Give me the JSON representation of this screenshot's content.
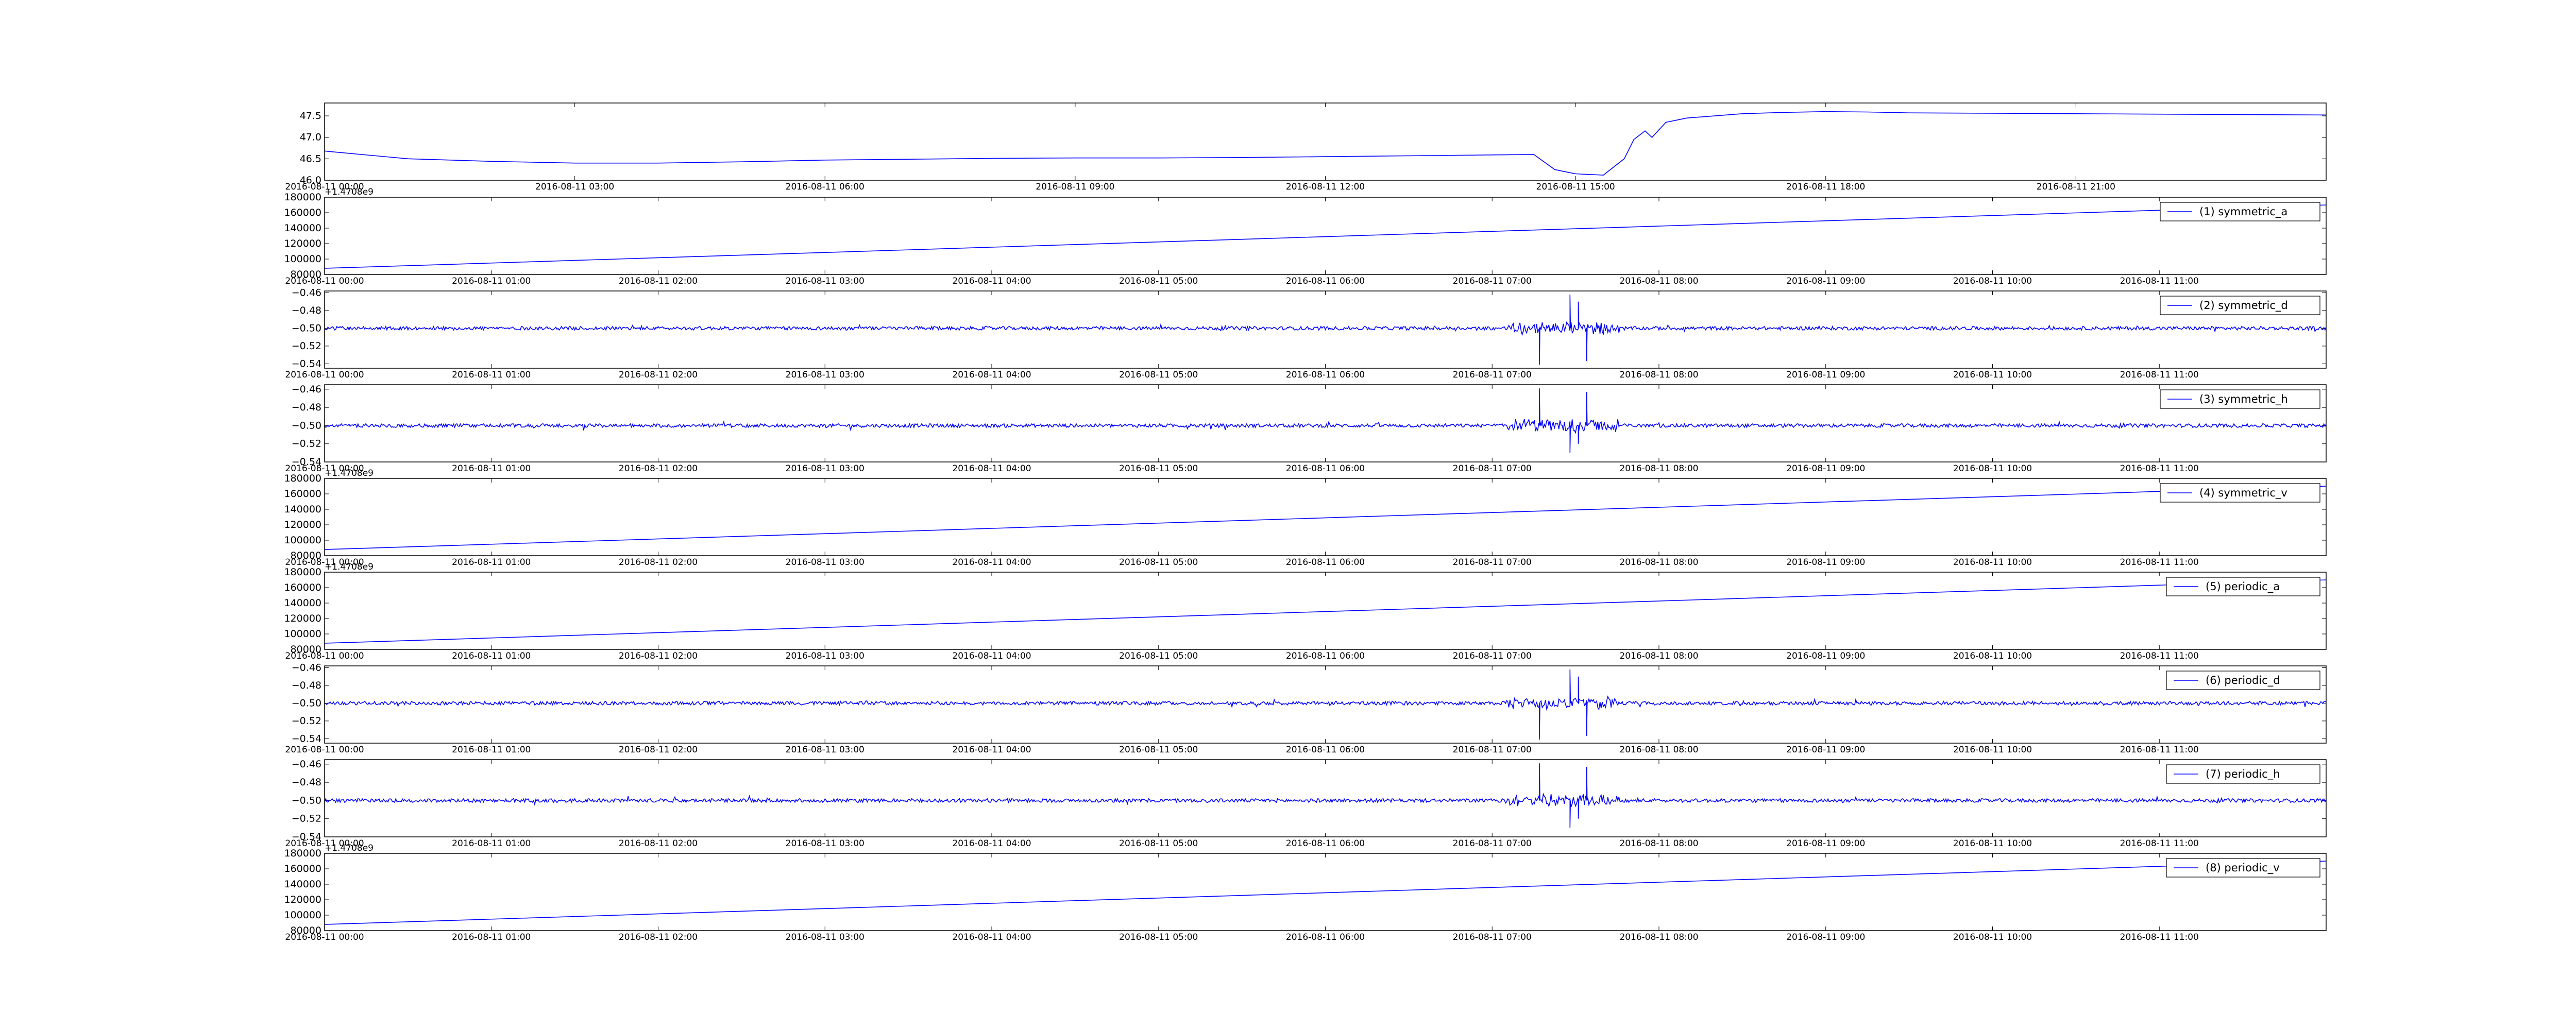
{
  "chart_data": [
    {
      "type": "line",
      "title": "",
      "xlabel": "",
      "ylabel": "",
      "legend": null,
      "grid": false,
      "x_tick_labels": [
        "2016-08-11 00:00",
        "2016-08-11 03:00",
        "2016-08-11 06:00",
        "2016-08-11 09:00",
        "2016-08-11 12:00",
        "2016-08-11 15:00",
        "2016-08-11 18:00",
        "2016-08-11 21:00"
      ],
      "y_tick_labels": [
        "46.0",
        "46.5",
        "47.0",
        "47.5"
      ],
      "xlim": [
        "2016-08-11 00:00",
        "2016-08-11 24:00"
      ],
      "ylim": [
        46.0,
        47.8
      ],
      "color": "#0000ff",
      "series": [
        {
          "x": [
            "00:00",
            "01:00",
            "02:00",
            "03:00",
            "04:00",
            "05:00",
            "06:00",
            "07:00",
            "08:00",
            "09:00",
            "10:00",
            "11:00",
            "12:00",
            "13:00",
            "14:00",
            "14:30",
            "14:45",
            "15:00",
            "15:20",
            "15:35",
            "15:42",
            "15:50",
            "15:55",
            "16:05",
            "16:20",
            "17:00",
            "17:30",
            "18:00",
            "18:30",
            "19:00",
            "20:00",
            "21:00",
            "22:00",
            "23:00",
            "24:00"
          ],
          "values": [
            46.68,
            46.5,
            46.44,
            46.4,
            46.4,
            46.43,
            46.47,
            46.49,
            46.51,
            46.52,
            46.52,
            46.53,
            46.55,
            46.57,
            46.59,
            46.6,
            46.25,
            46.15,
            46.12,
            46.5,
            46.95,
            47.15,
            47.0,
            47.35,
            47.45,
            47.55,
            47.58,
            47.6,
            47.59,
            47.57,
            47.56,
            47.55,
            47.54,
            47.53,
            47.52
          ]
        }
      ]
    },
    {
      "type": "line",
      "legend": "(1) symmetric_a",
      "legend_placement": "top-right",
      "offset_text": "+1.4708e9",
      "x_tick_labels": [
        "2016-08-11 00:00",
        "2016-08-11 01:00",
        "2016-08-11 02:00",
        "2016-08-11 03:00",
        "2016-08-11 04:00",
        "2016-08-11 05:00",
        "2016-08-11 06:00",
        "2016-08-11 07:00",
        "2016-08-11 08:00",
        "2016-08-11 09:00",
        "2016-08-11 10:00",
        "2016-08-11 11:00"
      ],
      "y_tick_labels": [
        "80000",
        "100000",
        "120000",
        "140000",
        "160000",
        "180000"
      ],
      "xlim": [
        "2016-08-11 00:00",
        "2016-08-11 12:00"
      ],
      "ylim": [
        80000,
        180000
      ],
      "color": "#0000ff",
      "series": [
        {
          "name": "(1) symmetric_a",
          "x": [
            "00:00",
            "12:00"
          ],
          "values": [
            88000,
            170000
          ]
        }
      ]
    },
    {
      "type": "line",
      "legend": "(2) symmetric_d",
      "legend_placement": "top-right",
      "pattern": "burst_up",
      "x_tick_labels": [
        "2016-08-11 00:00",
        "2016-08-11 01:00",
        "2016-08-11 02:00",
        "2016-08-11 03:00",
        "2016-08-11 04:00",
        "2016-08-11 05:00",
        "2016-08-11 06:00",
        "2016-08-11 07:00",
        "2016-08-11 08:00",
        "2016-08-11 09:00",
        "2016-08-11 10:00",
        "2016-08-11 11:00"
      ],
      "y_tick_labels": [
        "−0.54",
        "−0.52",
        "−0.50",
        "−0.48",
        "−0.46"
      ],
      "xlim": [
        "2016-08-11 00:00",
        "2016-08-11 12:00"
      ],
      "ylim": [
        -0.545,
        -0.458
      ],
      "baseline": -0.5,
      "color": "#0000ff",
      "series": [
        {
          "name": "(2) symmetric_d",
          "baseline": -0.5,
          "noise_amplitude": 0.002,
          "spikes": [
            {
              "x": "07:17",
              "value": -0.541
            },
            {
              "x": "07:28",
              "value": -0.462
            },
            {
              "x": "07:31",
              "value": -0.47
            },
            {
              "x": "07:34",
              "value": -0.537
            }
          ]
        }
      ]
    },
    {
      "type": "line",
      "legend": "(3) symmetric_h",
      "legend_placement": "top-right",
      "pattern": "burst_down",
      "x_tick_labels": [
        "2016-08-11 00:00",
        "2016-08-11 01:00",
        "2016-08-11 02:00",
        "2016-08-11 03:00",
        "2016-08-11 04:00",
        "2016-08-11 05:00",
        "2016-08-11 06:00",
        "2016-08-11 07:00",
        "2016-08-11 08:00",
        "2016-08-11 09:00",
        "2016-08-11 10:00",
        "2016-08-11 11:00"
      ],
      "y_tick_labels": [
        "−0.54",
        "−0.52",
        "−0.50",
        "−0.48",
        "−0.46"
      ],
      "xlim": [
        "2016-08-11 00:00",
        "2016-08-11 12:00"
      ],
      "ylim": [
        -0.54,
        -0.455
      ],
      "baseline": -0.5,
      "color": "#0000ff",
      "series": [
        {
          "name": "(3) symmetric_h",
          "baseline": -0.5,
          "noise_amplitude": 0.002,
          "spikes": [
            {
              "x": "07:17",
              "value": -0.459
            },
            {
              "x": "07:28",
              "value": -0.53
            },
            {
              "x": "07:31",
              "value": -0.52
            },
            {
              "x": "07:34",
              "value": -0.463
            }
          ]
        }
      ]
    },
    {
      "type": "line",
      "legend": "(4) symmetric_v",
      "legend_placement": "top-right",
      "offset_text": "+1.4708e9",
      "x_tick_labels": [
        "2016-08-11 00:00",
        "2016-08-11 01:00",
        "2016-08-11 02:00",
        "2016-08-11 03:00",
        "2016-08-11 04:00",
        "2016-08-11 05:00",
        "2016-08-11 06:00",
        "2016-08-11 07:00",
        "2016-08-11 08:00",
        "2016-08-11 09:00",
        "2016-08-11 10:00",
        "2016-08-11 11:00"
      ],
      "y_tick_labels": [
        "80000",
        "100000",
        "120000",
        "140000",
        "160000",
        "180000"
      ],
      "xlim": [
        "2016-08-11 00:00",
        "2016-08-11 12:00"
      ],
      "ylim": [
        80000,
        180000
      ],
      "color": "#0000ff",
      "series": [
        {
          "name": "(4) symmetric_v",
          "x": [
            "00:00",
            "12:00"
          ],
          "values": [
            88000,
            170000
          ]
        }
      ]
    },
    {
      "type": "line",
      "legend": "(5) periodic_a",
      "legend_placement": "top-right",
      "offset_text": "+1.4708e9",
      "x_tick_labels": [
        "2016-08-11 00:00",
        "2016-08-11 01:00",
        "2016-08-11 02:00",
        "2016-08-11 03:00",
        "2016-08-11 04:00",
        "2016-08-11 05:00",
        "2016-08-11 06:00",
        "2016-08-11 07:00",
        "2016-08-11 08:00",
        "2016-08-11 09:00",
        "2016-08-11 10:00",
        "2016-08-11 11:00"
      ],
      "y_tick_labels": [
        "80000",
        "100000",
        "120000",
        "140000",
        "160000",
        "180000"
      ],
      "xlim": [
        "2016-08-11 00:00",
        "2016-08-11 12:00"
      ],
      "ylim": [
        80000,
        180000
      ],
      "color": "#0000ff",
      "series": [
        {
          "name": "(5) periodic_a",
          "x": [
            "00:00",
            "12:00"
          ],
          "values": [
            88000,
            170000
          ]
        }
      ]
    },
    {
      "type": "line",
      "legend": "(6) periodic_d",
      "legend_placement": "top-right",
      "pattern": "burst_up",
      "x_tick_labels": [
        "2016-08-11 00:00",
        "2016-08-11 01:00",
        "2016-08-11 02:00",
        "2016-08-11 03:00",
        "2016-08-11 04:00",
        "2016-08-11 05:00",
        "2016-08-11 06:00",
        "2016-08-11 07:00",
        "2016-08-11 08:00",
        "2016-08-11 09:00",
        "2016-08-11 10:00",
        "2016-08-11 11:00"
      ],
      "y_tick_labels": [
        "−0.54",
        "−0.52",
        "−0.50",
        "−0.48",
        "−0.46"
      ],
      "xlim": [
        "2016-08-11 00:00",
        "2016-08-11 12:00"
      ],
      "ylim": [
        -0.545,
        -0.458
      ],
      "baseline": -0.5,
      "color": "#0000ff",
      "series": [
        {
          "name": "(6) periodic_d",
          "baseline": -0.5,
          "noise_amplitude": 0.002,
          "spikes": [
            {
              "x": "07:17",
              "value": -0.541
            },
            {
              "x": "07:28",
              "value": -0.462
            },
            {
              "x": "07:31",
              "value": -0.47
            },
            {
              "x": "07:34",
              "value": -0.537
            }
          ]
        }
      ]
    },
    {
      "type": "line",
      "legend": "(7) periodic_h",
      "legend_placement": "top-right",
      "pattern": "burst_down",
      "x_tick_labels": [
        "2016-08-11 00:00",
        "2016-08-11 01:00",
        "2016-08-11 02:00",
        "2016-08-11 03:00",
        "2016-08-11 04:00",
        "2016-08-11 05:00",
        "2016-08-11 06:00",
        "2016-08-11 07:00",
        "2016-08-11 08:00",
        "2016-08-11 09:00",
        "2016-08-11 10:00",
        "2016-08-11 11:00"
      ],
      "y_tick_labels": [
        "−0.54",
        "−0.52",
        "−0.50",
        "−0.48",
        "−0.46"
      ],
      "xlim": [
        "2016-08-11 00:00",
        "2016-08-11 12:00"
      ],
      "ylim": [
        -0.54,
        -0.455
      ],
      "baseline": -0.5,
      "color": "#0000ff",
      "series": [
        {
          "name": "(7) periodic_h",
          "baseline": -0.5,
          "noise_amplitude": 0.002,
          "spikes": [
            {
              "x": "07:17",
              "value": -0.459
            },
            {
              "x": "07:28",
              "value": -0.53
            },
            {
              "x": "07:31",
              "value": -0.52
            },
            {
              "x": "07:34",
              "value": -0.463
            }
          ]
        }
      ]
    },
    {
      "type": "line",
      "legend": "(8) periodic_v",
      "legend_placement": "top-right",
      "offset_text": "+1.4708e9",
      "x_tick_labels": [
        "2016-08-11 00:00",
        "2016-08-11 01:00",
        "2016-08-11 02:00",
        "2016-08-11 03:00",
        "2016-08-11 04:00",
        "2016-08-11 05:00",
        "2016-08-11 06:00",
        "2016-08-11 07:00",
        "2016-08-11 08:00",
        "2016-08-11 09:00",
        "2016-08-11 10:00",
        "2016-08-11 11:00"
      ],
      "y_tick_labels": [
        "80000",
        "100000",
        "120000",
        "140000",
        "160000",
        "180000"
      ],
      "xlim": [
        "2016-08-11 00:00",
        "2016-08-11 12:00"
      ],
      "ylim": [
        80000,
        180000
      ],
      "color": "#0000ff",
      "series": [
        {
          "name": "(8) periodic_v",
          "x": [
            "00:00",
            "12:00"
          ],
          "values": [
            88000,
            170000
          ]
        }
      ]
    }
  ]
}
